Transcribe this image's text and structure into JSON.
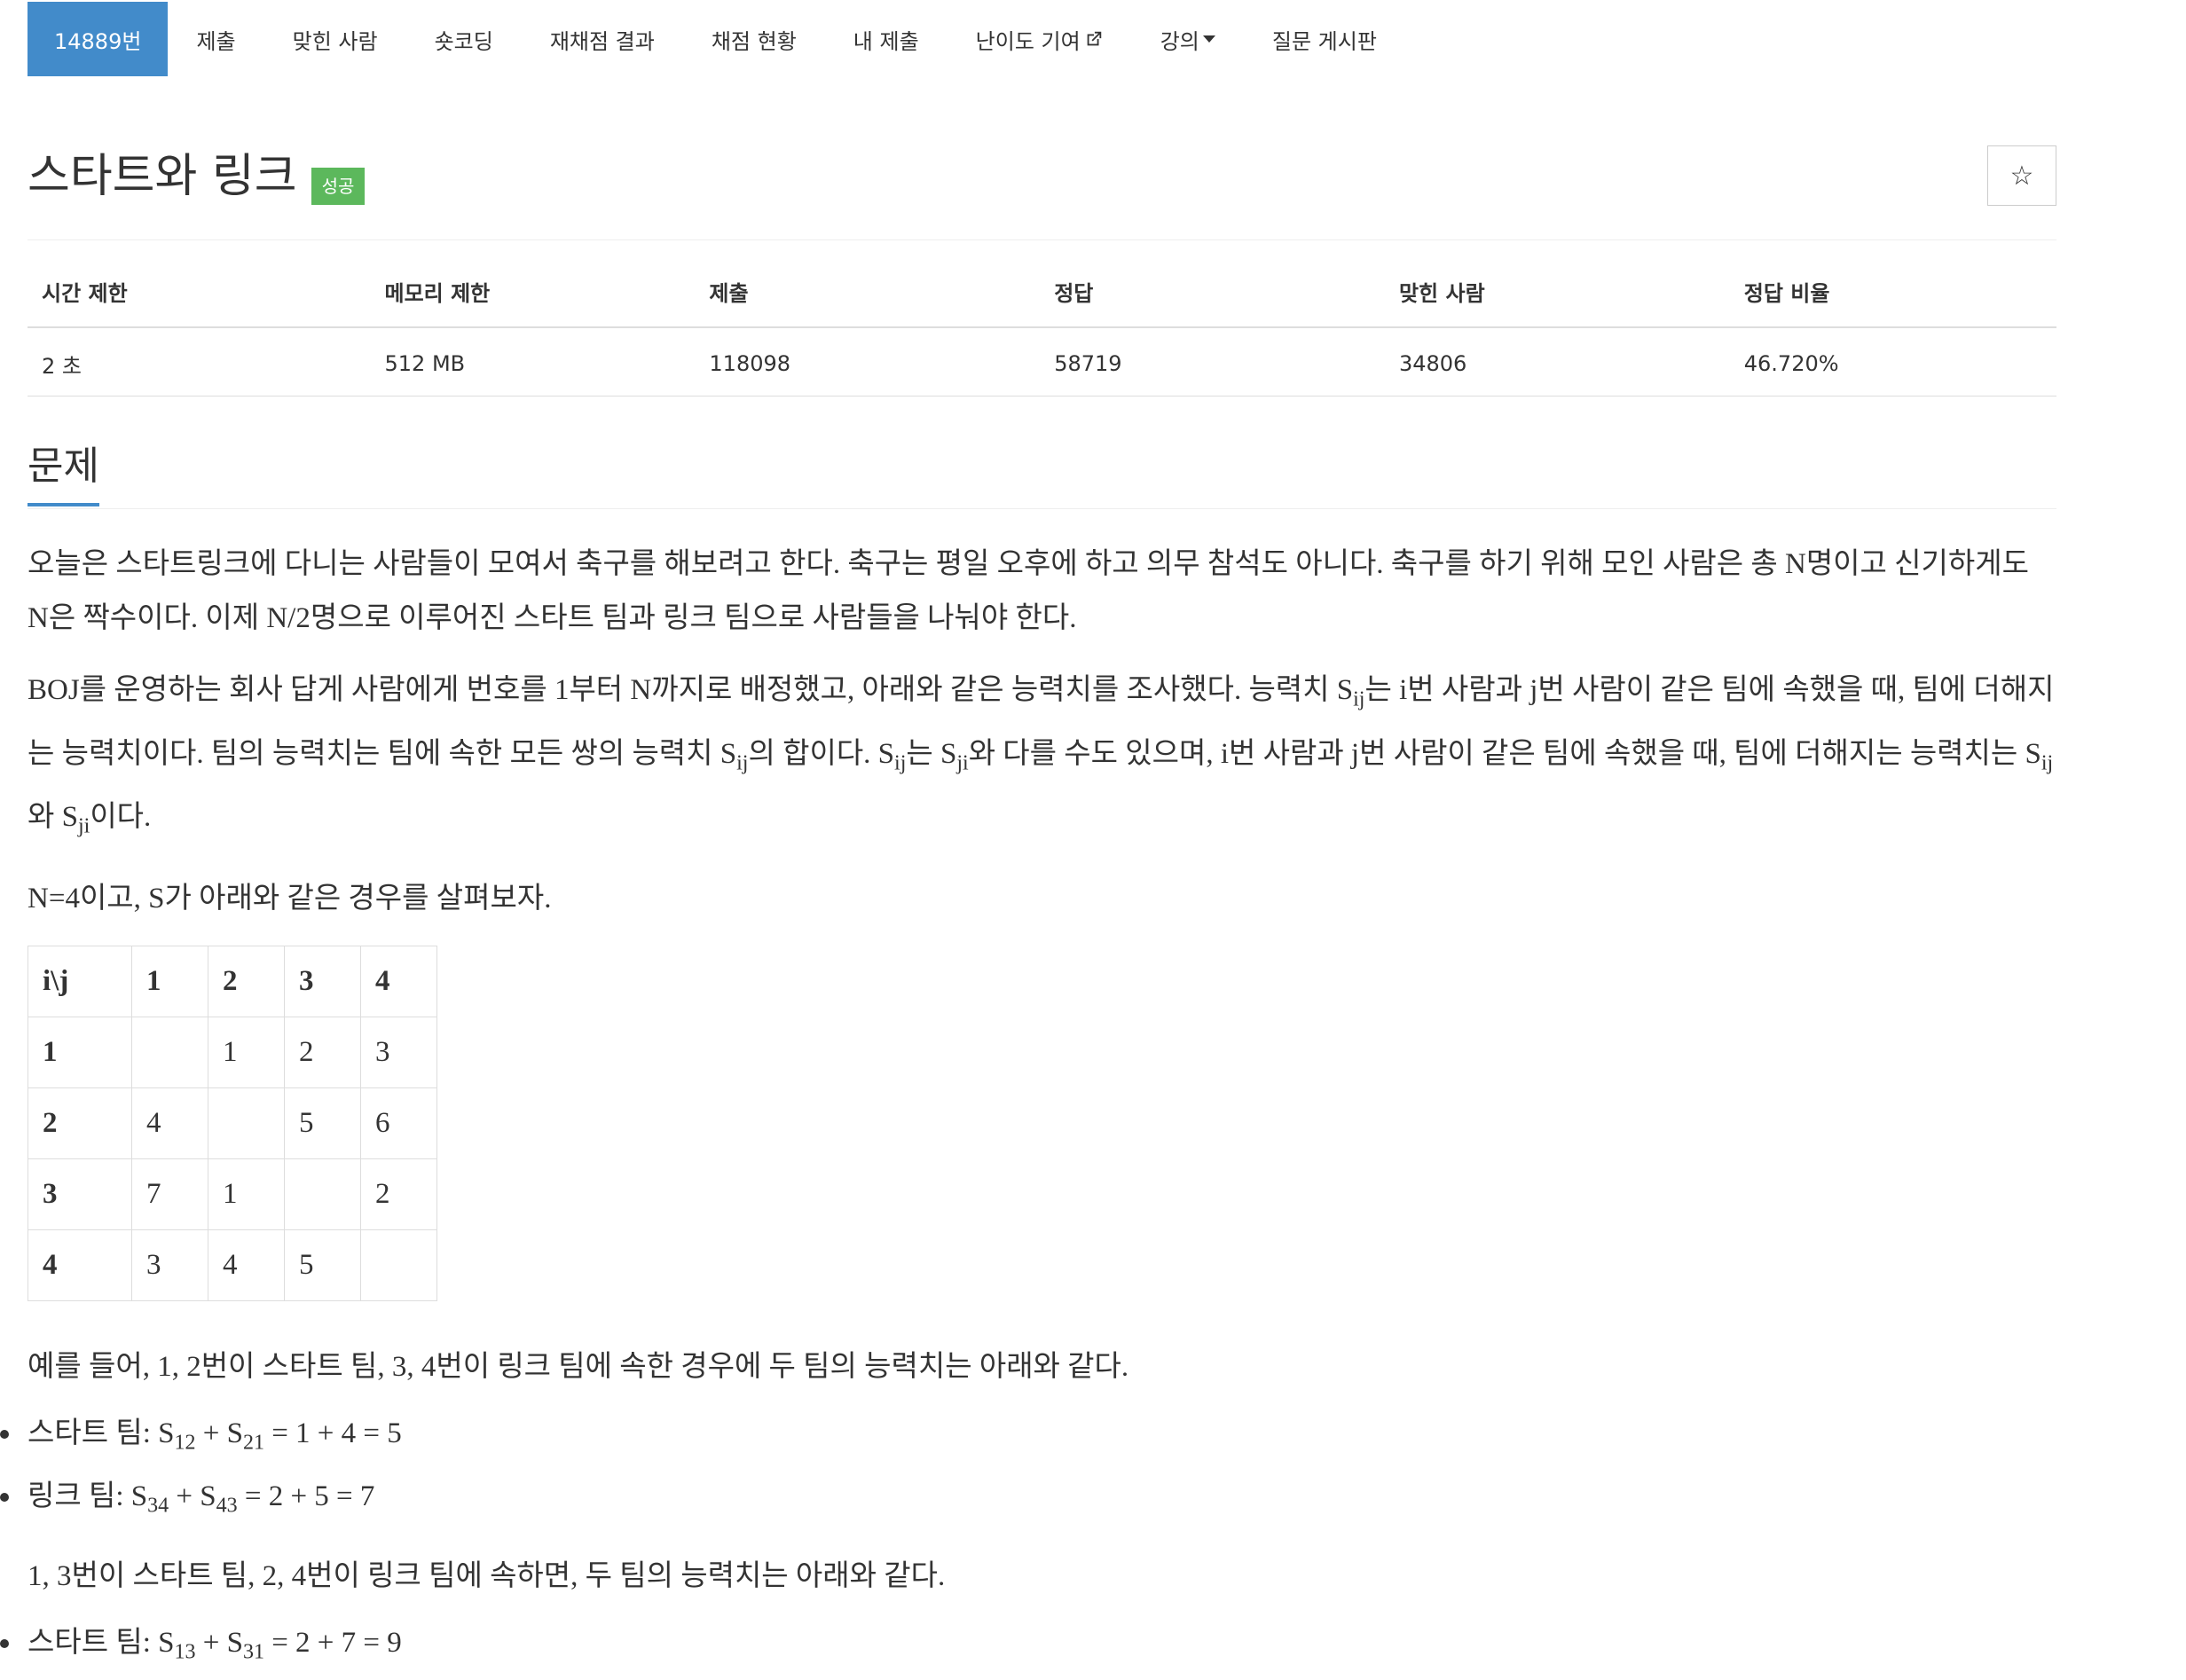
{
  "nav": {
    "items": [
      {
        "label": "14889번"
      },
      {
        "label": "제출"
      },
      {
        "label": "맞힌 사람"
      },
      {
        "label": "숏코딩"
      },
      {
        "label": "재채점 결과"
      },
      {
        "label": "채점 현황"
      },
      {
        "label": "내 제출"
      },
      {
        "label": "난이도 기여"
      },
      {
        "label": "강의"
      },
      {
        "label": "질문 게시판"
      }
    ]
  },
  "header": {
    "title": "스타트와 링크",
    "badge": "성공",
    "star": "☆"
  },
  "info": {
    "headers": [
      "시간 제한",
      "메모리 제한",
      "제출",
      "정답",
      "맞힌 사람",
      "정답 비율"
    ],
    "values": [
      "2 초",
      "512 MB",
      "118098",
      "58719",
      "34806",
      "46.720%"
    ]
  },
  "section": {
    "title": "문제"
  },
  "problem": {
    "p1": "오늘은 스타트링크에 다니는 사람들이 모여서 축구를 해보려고 한다. 축구는 평일 오후에 하고 의무 참석도 아니다. 축구를 하기 위해 모인 사람은 총 N명이고 신기하게도 N은 짝수이다. 이제 N/2명으로 이루어진 스타트 팀과 링크 팀으로 사람들을 나눠야 한다.",
    "p2_a": "BOJ를 운영하는 회사 답게 사람에게 번호를 1부터 N까지로 배정했고, 아래와 같은 능력치를 조사했다. 능력치 S",
    "p2_b": "는 i번 사람과 j번 사람이 같은 팀에 속했을 때, 팀에 더해지는 능력치이다. 팀의 능력치는 팀에 속한 모든 쌍의 능력치 S",
    "p2_c": "의 합이다. S",
    "p2_d": "는 S",
    "p2_e": "와 다를 수도 있으며, i번 사람과 j번 사람이 같은 팀에 속했을 때, 팀에 더해지는 능력치는 S",
    "p2_f": "와 S",
    "p2_g": "이다.",
    "sub_ij": "ij",
    "sub_ji": "ji",
    "p3": "N=4이고, S가 아래와 같은 경우를 살펴보자.",
    "p4": "예를 들어, 1, 2번이 스타트 팀, 3, 4번이 링크 팀에 속한 경우에 두 팀의 능력치는 아래와 같다.",
    "b1_label": "스타트 팀: S",
    "b1_s1": "12",
    "b1_mid": " + S",
    "b1_s2": "21",
    "b1_end": " = 1 + 4 = 5",
    "b2_label": "링크 팀: S",
    "b2_s1": "34",
    "b2_mid": " + S",
    "b2_s2": "43",
    "b2_end": " = 2 + 5 = 7",
    "p5": "1, 3번이 스타트 팀, 2, 4번이 링크 팀에 속하면, 두 팀의 능력치는 아래와 같다.",
    "b3_label": "스타트 팀: S",
    "b3_s1": "13",
    "b3_mid": " + S",
    "b3_s2": "31",
    "b3_end": " = 2 + 7 = 9"
  },
  "grid": {
    "header": [
      "i\\j",
      "1",
      "2",
      "3",
      "4"
    ],
    "rows": [
      [
        "1",
        "",
        "1",
        "2",
        "3"
      ],
      [
        "2",
        "4",
        "",
        "5",
        "6"
      ],
      [
        "3",
        "7",
        "1",
        "",
        "2"
      ],
      [
        "4",
        "3",
        "4",
        "5",
        ""
      ]
    ]
  }
}
